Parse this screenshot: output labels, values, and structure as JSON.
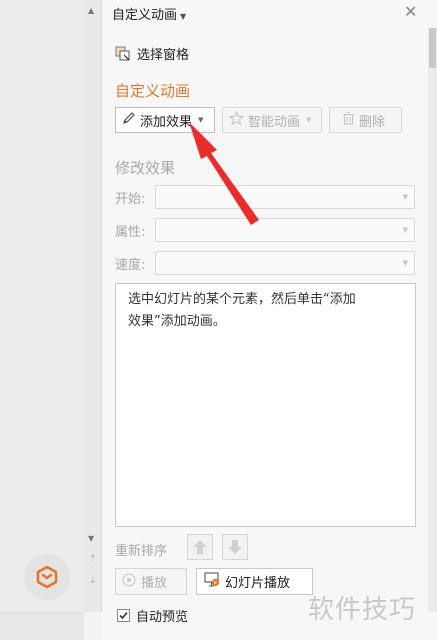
{
  "panel": {
    "title": "自定义动画",
    "selection_pane_label": "选择窗格",
    "section_title": "自定义动画"
  },
  "toolbar": {
    "add_effect": "添加效果",
    "smart_animation": "智能动画",
    "delete": "删除"
  },
  "modify": {
    "title": "修改效果",
    "start_label": "开始:",
    "property_label": "属性:",
    "speed_label": "速度:"
  },
  "list": {
    "hint_line1": "选中幻灯片的某个元素，然后单击“添加",
    "hint_line2": "效果”添加动画。"
  },
  "reorder": {
    "label": "重新排序"
  },
  "playback": {
    "play": "播放",
    "slideshow": "幻灯片播放"
  },
  "auto_preview": {
    "label": "自动预览",
    "checked": true
  },
  "watermark": {
    "text": "软件技巧"
  },
  "colors": {
    "accent": "#e07a2c",
    "annotation_arrow": "#ee2b2b"
  }
}
